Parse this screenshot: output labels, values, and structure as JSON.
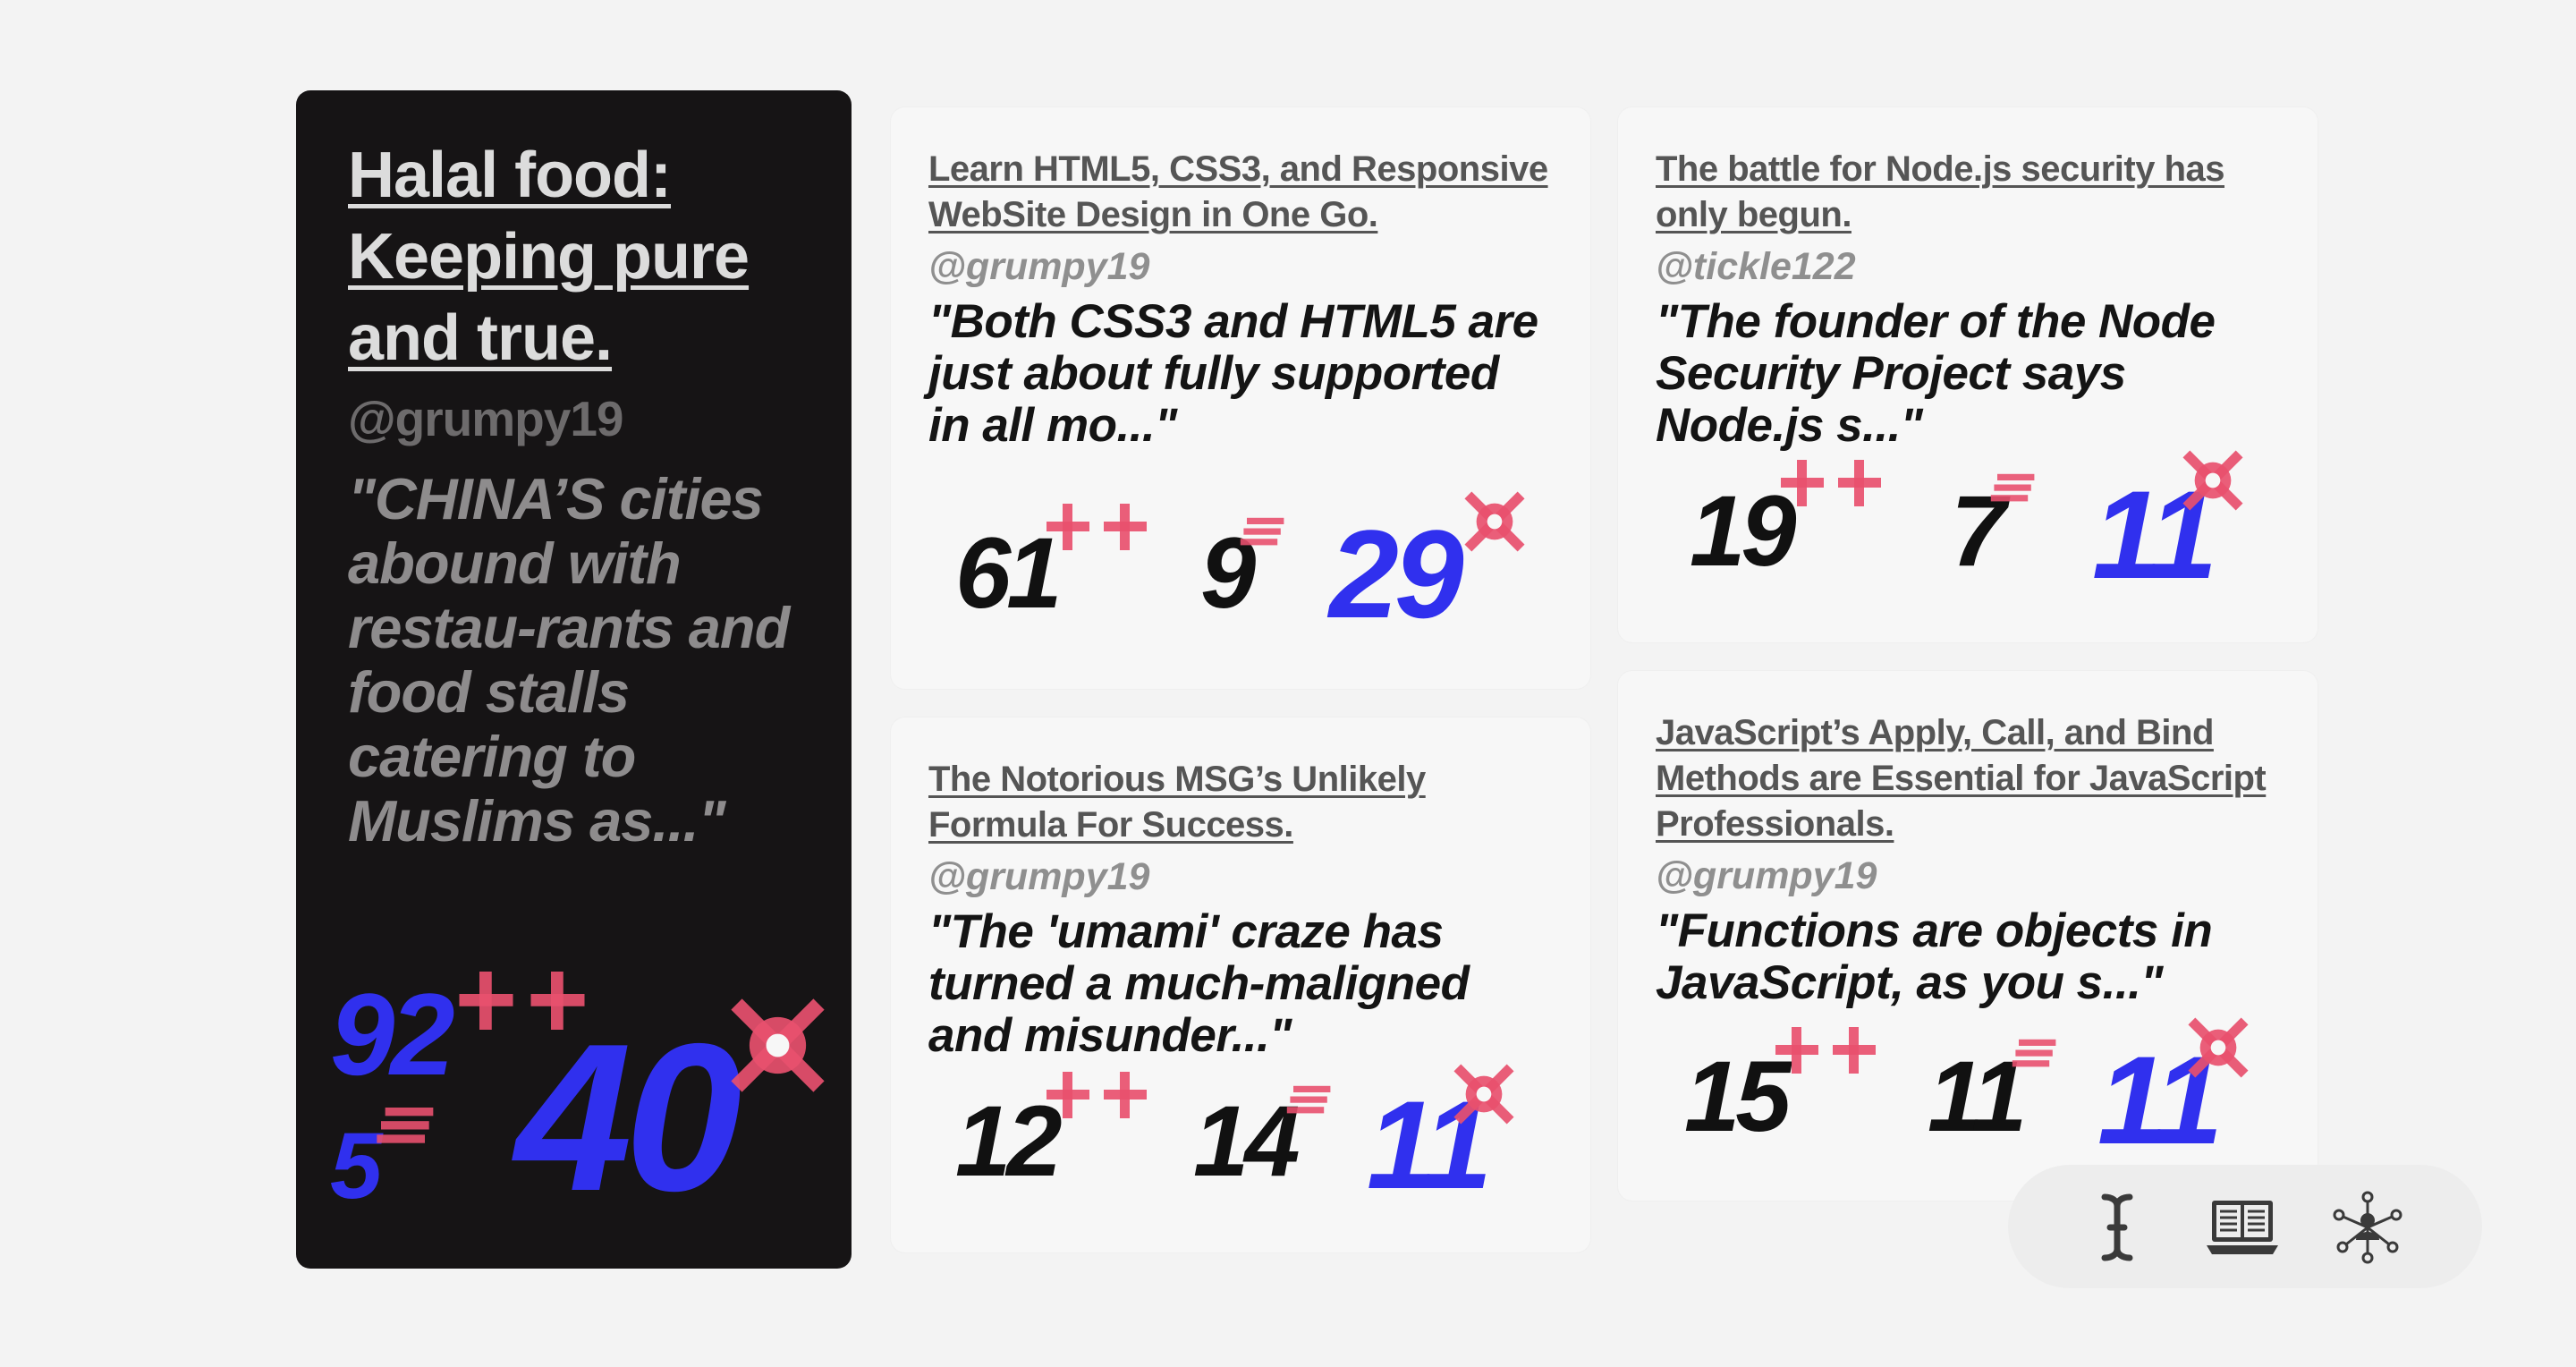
{
  "feature": {
    "title": "Halal food: Keeping pure and true.",
    "handle": "@grumpy19",
    "quote": "\"CHINA’S cities abound with restau-rants and food stalls catering to Muslims as...\"",
    "plus": "92",
    "equal": "5",
    "target": "40"
  },
  "cards": [
    {
      "title": "Learn HTML5, CSS3, and Responsive WebSite Design in One Go.",
      "handle": "@grumpy19",
      "quote": "\"Both CSS3 and HTML5 are just about fully supported in all mo...\"",
      "plus": "61",
      "equal": "9",
      "target": "29"
    },
    {
      "title": "The battle for Node.js security has only begun.",
      "handle": "@tickle122",
      "quote": "\"The founder of the Node Security Project says Node.js s...\"",
      "plus": "19",
      "equal": "7",
      "target": "11"
    },
    {
      "title": "The Notorious MSG’s Unlikely Formula For Success.",
      "handle": "@grumpy19",
      "quote": "\"The 'umami' craze has turned a much-maligned and misunder...\"",
      "plus": "12",
      "equal": "14",
      "target": "11"
    },
    {
      "title": "JavaScript’s Apply, Call, and Bind Methods are Essential for JavaScript Professionals.",
      "handle": "@grumpy19",
      "quote": "\"Functions are objects in JavaScript, as you s...\"",
      "plus": "15",
      "equal": "11",
      "target": "11"
    }
  ],
  "dock": {
    "tools": [
      "text-cursor-icon",
      "laptop-book-icon",
      "network-person-icon"
    ]
  },
  "colors": {
    "blue": "#3030ee",
    "mark": "#e8506e",
    "dark": "#161415"
  }
}
